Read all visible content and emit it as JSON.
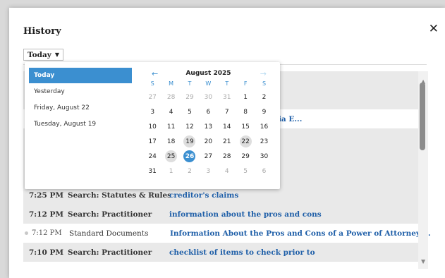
{
  "modal": {
    "title": "History",
    "close_label": "✕",
    "filter_label": "Today"
  },
  "rows": [
    {
      "time": "",
      "type": "",
      "desc": "",
      "style": "shade"
    },
    {
      "time": "",
      "type": "",
      "desc": "",
      "style": "shade"
    },
    {
      "time": "",
      "type": "",
      "desc": "ractice Under the California E...",
      "style": "white"
    },
    {
      "time": "",
      "type": "",
      "desc": "",
      "style": "shade"
    },
    {
      "time": "",
      "type": "",
      "desc": "",
      "style": "shade"
    },
    {
      "time": "",
      "type": "",
      "desc": "",
      "style": "shade"
    },
    {
      "time": "7:25 PM",
      "type": "Search: Statutes & Rules",
      "desc": "creditor's claims",
      "style": "shade"
    },
    {
      "time": "7:12 PM",
      "type": "Search: Practitioner",
      "desc": "information about the pros and cons",
      "style": "shade"
    },
    {
      "time": "7:12 PM",
      "type": "Standard Documents",
      "desc": "Information About the Pros and Cons of a Power of Attorney ...",
      "style": "white doc"
    },
    {
      "time": "7:10 PM",
      "type": "Search: Practitioner",
      "desc": "checklist of items to check prior to",
      "style": "shade"
    }
  ],
  "dropdown": {
    "presets": [
      "Today",
      "Yesterday",
      "Friday, August 22",
      "Tuesday, August 19"
    ],
    "active_preset": "Today",
    "calendar": {
      "month_label": "August 2025",
      "prev_label": "←",
      "next_label": "→",
      "weekdays": [
        "S",
        "M",
        "T",
        "W",
        "T",
        "F",
        "S"
      ],
      "days": [
        {
          "d": "27",
          "muted": true
        },
        {
          "d": "28",
          "muted": true
        },
        {
          "d": "29",
          "muted": true
        },
        {
          "d": "30",
          "muted": true
        },
        {
          "d": "31",
          "muted": true
        },
        {
          "d": "1"
        },
        {
          "d": "2"
        },
        {
          "d": "3"
        },
        {
          "d": "4"
        },
        {
          "d": "5"
        },
        {
          "d": "6"
        },
        {
          "d": "7"
        },
        {
          "d": "8"
        },
        {
          "d": "9"
        },
        {
          "d": "10"
        },
        {
          "d": "11"
        },
        {
          "d": "12"
        },
        {
          "d": "13"
        },
        {
          "d": "14"
        },
        {
          "d": "15"
        },
        {
          "d": "16"
        },
        {
          "d": "17"
        },
        {
          "d": "18"
        },
        {
          "d": "19",
          "marked": true
        },
        {
          "d": "20"
        },
        {
          "d": "21"
        },
        {
          "d": "22",
          "marked": true
        },
        {
          "d": "23"
        },
        {
          "d": "24"
        },
        {
          "d": "25",
          "marked": true
        },
        {
          "d": "26",
          "selected": true
        },
        {
          "d": "27"
        },
        {
          "d": "28"
        },
        {
          "d": "29"
        },
        {
          "d": "30"
        },
        {
          "d": "31"
        },
        {
          "d": "1",
          "muted": true
        },
        {
          "d": "2",
          "muted": true
        },
        {
          "d": "3",
          "muted": true
        },
        {
          "d": "4",
          "muted": true
        },
        {
          "d": "5",
          "muted": true
        },
        {
          "d": "6",
          "muted": true
        }
      ]
    }
  },
  "colors": {
    "accent": "#3b8fd0",
    "link": "#1f5fa8"
  }
}
